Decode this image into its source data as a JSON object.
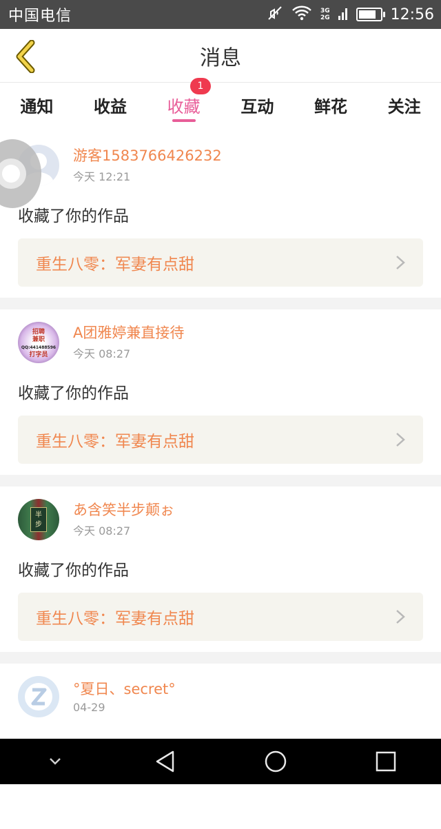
{
  "status_bar": {
    "carrier": "中国电信",
    "network_top": "3G",
    "network_bottom": "2G",
    "time": "12:56",
    "battery_level": 0.85
  },
  "header": {
    "title": "消息",
    "back_icon": "chevron-left-icon"
  },
  "tabs": [
    {
      "label": "通知",
      "active": false
    },
    {
      "label": "收益",
      "active": false
    },
    {
      "label": "收藏",
      "active": true,
      "badge": "1"
    },
    {
      "label": "互动",
      "active": false
    },
    {
      "label": "鲜花",
      "active": false
    },
    {
      "label": "关注",
      "active": false
    }
  ],
  "messages": [
    {
      "user": "游客1583766426232",
      "time": "今天 12:21",
      "text": "收藏了你的作品",
      "work_title": "重生八零：军妻有点甜",
      "avatar": "default-avatar"
    },
    {
      "user": "A团雅婷兼直接待",
      "time": "今天 08:27",
      "text": "收藏了你的作品",
      "work_title": "重生八零：军妻有点甜",
      "avatar": "ad-avatar",
      "avatar_text": [
        "招聘",
        "兼职",
        "QQ:441488596",
        "打字员"
      ]
    },
    {
      "user": "あ含笑半步颠ぉ",
      "time": "今天 08:27",
      "text": "收藏了你的作品",
      "work_title": "重生八零：军妻有点甜",
      "avatar": "photo-avatar",
      "avatar_text": [
        "半",
        "步"
      ]
    },
    {
      "user": "°夏日、secret°",
      "time": "04-29",
      "avatar": "qq-avatar"
    }
  ],
  "colors": {
    "accent_pink": "#e85d98",
    "orange_text": "#f0874f",
    "badge_red": "#ef3a4f",
    "card_bg": "#f5f4ee"
  },
  "nav": {
    "down": "chevron-down-icon",
    "back": "triangle-back-icon",
    "home": "circle-home-icon",
    "recent": "square-recent-icon"
  }
}
